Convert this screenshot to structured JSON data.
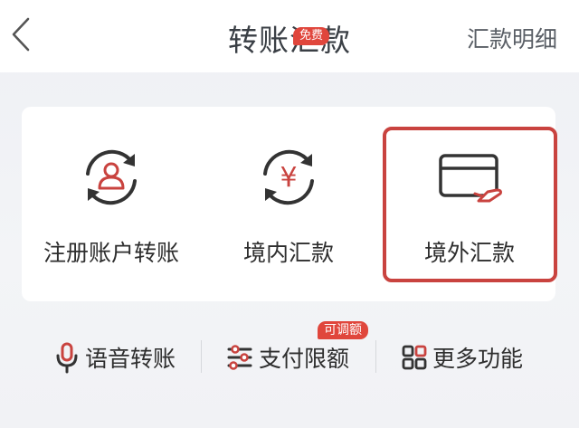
{
  "header": {
    "title": "转账汇款",
    "right_link": "汇款明细"
  },
  "tiles": [
    {
      "label": "注册账户转账",
      "icon": "person-refresh-icon"
    },
    {
      "label": "境内汇款",
      "icon": "yuan-refresh-icon",
      "badge": "免费"
    },
    {
      "label": "境外汇款",
      "icon": "card-plane-icon",
      "selected": true
    }
  ],
  "bottom": [
    {
      "label": "语音转账",
      "icon": "microphone-icon"
    },
    {
      "label": "支付限额",
      "icon": "sliders-icon",
      "badge": "可调额"
    },
    {
      "label": "更多功能",
      "icon": "grid-icon"
    }
  ],
  "colors": {
    "accent": "#c9433f",
    "badge": "#e0463c",
    "text": "#2e2e2e"
  }
}
